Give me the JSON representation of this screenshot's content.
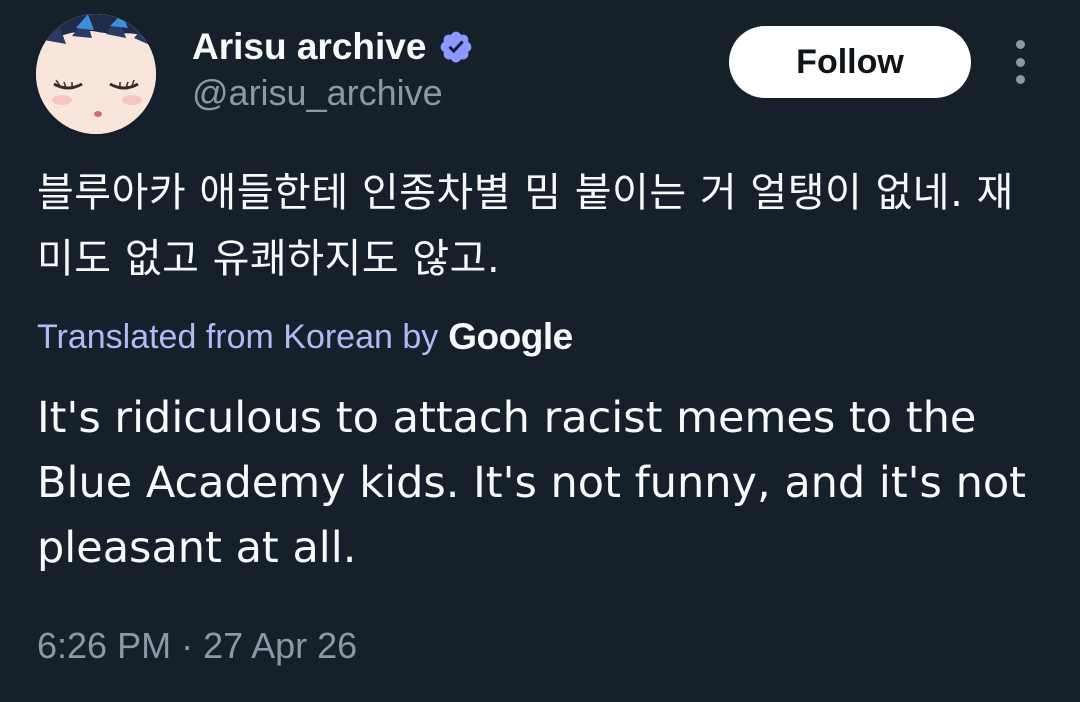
{
  "author": {
    "display_name": "Arisu archive",
    "handle": "@arisu_archive",
    "verified": true
  },
  "actions": {
    "follow_label": "Follow",
    "more_icon": "more-vertical-icon"
  },
  "tweet": {
    "original_text": "블루아카 애들한테 인종차별 밈 붙이는 거 얼탱이 없네. 재미도 없고 유쾌하지도 않고.",
    "translation_label": "Translated from Korean by",
    "translation_provider": "Google",
    "translated_text": "It's ridiculous to attach racist memes to the Blue Academy kids. It's not funny, and it's not pleasant at all.",
    "time": "6:26 PM",
    "separator": "·",
    "date": "27 Apr 26"
  },
  "colors": {
    "background": "#15202b",
    "text_primary": "#f7f9f9",
    "text_secondary": "#8b98a5",
    "translation_label": "#b3b9f5",
    "verified_badge": "#8b98ff",
    "follow_button_bg": "#ffffff"
  }
}
